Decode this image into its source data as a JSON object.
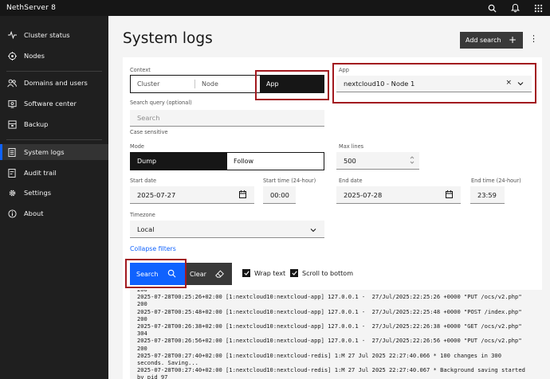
{
  "header": {
    "brand": "NethServer 8",
    "icons": [
      "search-icon",
      "notification-icon",
      "app-switcher-icon"
    ]
  },
  "sidebar": {
    "items": [
      {
        "label": "Cluster status",
        "icon": "activity-icon"
      },
      {
        "label": "Nodes",
        "icon": "nodes-icon"
      },
      {
        "label": "Domains and users",
        "icon": "users-icon"
      },
      {
        "label": "Software center",
        "icon": "software-icon"
      },
      {
        "label": "Backup",
        "icon": "backup-icon"
      },
      {
        "label": "System logs",
        "icon": "logs-icon",
        "active": true
      },
      {
        "label": "Audit trail",
        "icon": "audit-icon"
      },
      {
        "label": "Settings",
        "icon": "gear-icon"
      },
      {
        "label": "About",
        "icon": "info-icon"
      }
    ]
  },
  "page": {
    "title": "System logs",
    "add_search_label": "Add search"
  },
  "form": {
    "context_label": "Context",
    "context_options": [
      "Cluster",
      "Node",
      "App"
    ],
    "context_selected": "App",
    "app_label": "App",
    "app_value": "nextcloud10 - Node 1",
    "search_query_label": "Search query (optional)",
    "search_placeholder": "Search",
    "case_sensitive_label": "Case sensitive",
    "mode_label": "Mode",
    "mode_options": [
      "Dump",
      "Follow"
    ],
    "mode_selected": "Dump",
    "max_lines_label": "Max lines",
    "max_lines_value": "500",
    "start_date_label": "Start date",
    "start_date_value": "2025-07-27",
    "start_time_label": "Start time (24-hour)",
    "start_time_value": "00:00",
    "end_date_label": "End date",
    "end_date_value": "2025-07-28",
    "end_time_label": "End time (24-hour)",
    "end_time_value": "23:59",
    "timezone_label": "Timezone",
    "timezone_value": "Local",
    "collapse_filters_label": "Collapse filters",
    "search_button_label": "Search",
    "clear_button_label": "Clear",
    "wrap_text_label": "Wrap text",
    "wrap_text_checked": true,
    "scroll_to_bottom_label": "Scroll to bottom",
    "scroll_to_bottom_checked": true
  },
  "log_lines": [
    "200",
    "2025-07-28T00:25:26+02:00 [1:nextcloud10:nextcloud-app] 127.0.0.1 -  27/Jul/2025:22:25:26 +0000 \"PUT /ocs/v2.php\"",
    "200",
    "2025-07-28T00:25:48+02:00 [1:nextcloud10:nextcloud-app] 127.0.0.1 -  27/Jul/2025:22:25:48 +0000 \"POST /index.php\"",
    "200",
    "2025-07-28T00:26:38+02:00 [1:nextcloud10:nextcloud-app] 127.0.0.1 -  27/Jul/2025:22:26:38 +0000 \"GET /ocs/v2.php\"",
    "304",
    "2025-07-28T00:26:56+02:00 [1:nextcloud10:nextcloud-app] 127.0.0.1 -  27/Jul/2025:22:26:56 +0000 \"PUT /ocs/v2.php\"",
    "200",
    "2025-07-28T00:27:40+02:00 [1:nextcloud10:nextcloud-redis] 1:M 27 Jul 2025 22:27:40.066 * 100 changes in 300",
    "seconds. Saving...",
    "2025-07-28T00:27:40+02:00 [1:nextcloud10:nextcloud-redis] 1:M 27 Jul 2025 22:27:40.067 * Background saving started",
    "by pid 97"
  ]
}
